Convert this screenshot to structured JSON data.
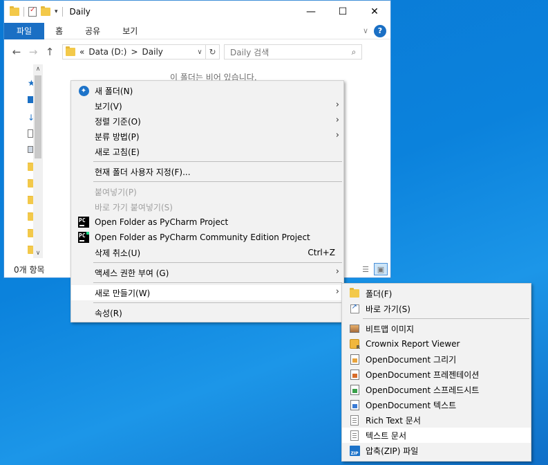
{
  "colors": {
    "accent": "#1a6fc4",
    "desktop": "#0b82dc",
    "folder": "#f3c94a"
  },
  "window": {
    "title": "Daily",
    "controls": {
      "minimize": "—",
      "maximize": "☐",
      "close": "✕"
    },
    "ribbon_tabs": [
      "파일",
      "홈",
      "공유",
      "보기"
    ],
    "ribbon_collapse": "∨",
    "help": "?",
    "nav": {
      "back": "←",
      "forward": "→",
      "up": "↑"
    },
    "address": {
      "prefix": "«",
      "segments": [
        "Data (D:)",
        "Daily"
      ],
      "separator": ">",
      "dropdown": "∨",
      "refresh": "↻"
    },
    "search_placeholder": "Daily 검색",
    "search_icon": "⌕",
    "empty_message": "이 폴더는 비어 있습니다.",
    "status": "0개 항목",
    "scroll_up": "∧",
    "scroll_down": "∨",
    "view_details_icon": "☰",
    "view_tiles_icon": "▣",
    "qat_caret": "▾"
  },
  "context_menu": {
    "items": [
      {
        "label": "새 폴더(N)",
        "icon": "new-folder-icon"
      },
      {
        "label": "보기(V)",
        "submenu": true
      },
      {
        "label": "정렬 기준(O)",
        "submenu": true
      },
      {
        "label": "분류 방법(P)",
        "submenu": true
      },
      {
        "label": "새로 고침(E)"
      },
      {
        "label": "현재 폴더 사용자 지정(F)..."
      },
      {
        "label": "붙여넣기(P)",
        "disabled": true
      },
      {
        "label": "바로 가기 붙여넣기(S)",
        "disabled": true
      },
      {
        "label": "Open Folder as PyCharm Project",
        "icon": "pycharm-icon"
      },
      {
        "label": "Open Folder as PyCharm Community Edition Project",
        "icon": "pycharm-ce-icon"
      },
      {
        "label": "삭제 취소(U)",
        "shortcut": "Ctrl+Z"
      },
      {
        "label": "액세스 권한 부여 (G)",
        "submenu": true
      },
      {
        "label": "새로 만들기(W)",
        "submenu": true,
        "highlighted": true
      },
      {
        "label": "속성(R)"
      }
    ],
    "arrow": "›"
  },
  "new_submenu": {
    "items": [
      {
        "label": "폴더(F)",
        "icon": "folder-icon"
      },
      {
        "label": "바로 가기(S)",
        "icon": "shortcut-icon"
      },
      {
        "label": "비트맵 이미지",
        "icon": "bitmap-icon"
      },
      {
        "label": "Crownix Report Viewer",
        "icon": "crownix-icon"
      },
      {
        "label": "OpenDocument 그리기",
        "icon": "odg-icon"
      },
      {
        "label": "OpenDocument 프레젠테이션",
        "icon": "odp-icon"
      },
      {
        "label": "OpenDocument 스프레드시트",
        "icon": "ods-icon"
      },
      {
        "label": "OpenDocument 텍스트",
        "icon": "odt-icon"
      },
      {
        "label": "Rich Text 문서",
        "icon": "rtf-icon"
      },
      {
        "label": "텍스트 문서",
        "icon": "text-document-icon",
        "highlighted": true
      },
      {
        "label": "압축(ZIP) 파일",
        "icon": "zip-icon"
      }
    ],
    "zip_badge": "ZIP"
  }
}
